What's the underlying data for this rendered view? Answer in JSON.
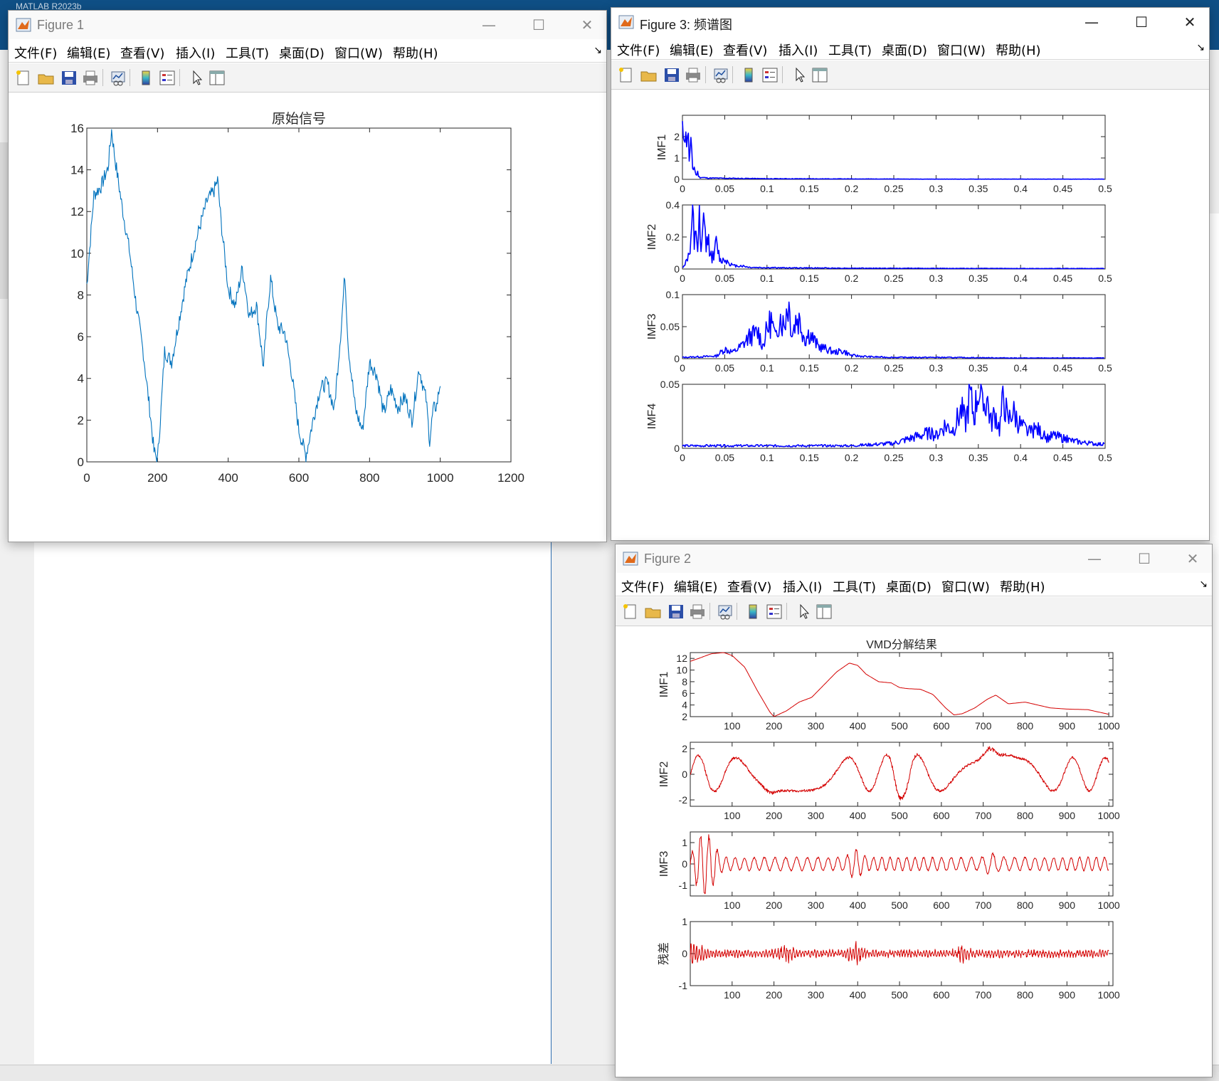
{
  "background": {
    "app_title": "MATLAB R2023b"
  },
  "menu": [
    "文件(F)",
    "编辑(E)",
    "查看(V)",
    "插入(I)",
    "工具(T)",
    "桌面(D)",
    "窗口(W)",
    "帮助(H)"
  ],
  "toolbar_icons": [
    "new-figure-icon",
    "open-file-icon",
    "save-icon",
    "print-icon",
    "link-plot-icon",
    "colorbar-icon",
    "legend-icon",
    "pointer-icon",
    "property-editor-icon"
  ],
  "window_controls": {
    "minimize": "—",
    "maximize": "☐",
    "close": "✕"
  },
  "windows": {
    "fig1": {
      "title": "Figure 1"
    },
    "fig3": {
      "title": "Figure 3: 频谱图"
    },
    "fig2": {
      "title": "Figure 2"
    }
  },
  "colors": {
    "blue_line": "#0072bd",
    "spectrum_line": "#0000ff",
    "vmd_line": "#d40000",
    "axis": "#262626"
  },
  "chart_data": [
    {
      "id": "original",
      "type": "line",
      "title": "原始信号",
      "xlim": [
        0,
        1200
      ],
      "ylim": [
        0,
        16
      ],
      "xticks": [
        0,
        200,
        400,
        600,
        800,
        1000,
        1200
      ],
      "yticks": [
        0,
        2,
        4,
        6,
        8,
        10,
        12,
        14,
        16
      ],
      "series": [
        {
          "x": [
            0,
            20,
            40,
            60,
            70,
            80,
            100,
            120,
            140,
            160,
            180,
            190,
            200,
            210,
            220,
            240,
            260,
            280,
            300,
            320,
            340,
            360,
            370,
            380,
            400,
            420,
            440,
            460,
            480,
            500,
            510,
            520,
            540,
            560,
            580,
            600,
            620,
            640,
            660,
            680,
            700,
            720,
            730,
            740,
            760,
            780,
            800,
            820,
            840,
            860,
            880,
            900,
            920,
            940,
            960,
            970,
            980,
            990,
            1000
          ],
          "y": [
            8.5,
            12.8,
            13.2,
            14.1,
            15.9,
            14.5,
            12.2,
            10.2,
            7.5,
            5.2,
            2.2,
            0.5,
            0.1,
            2.5,
            5.3,
            4.8,
            6.7,
            8.6,
            10.0,
            11.3,
            12.5,
            13.0,
            13.5,
            11.5,
            8.3,
            7.5,
            9.3,
            7.0,
            7.5,
            4.5,
            7.0,
            8.8,
            6.5,
            6.2,
            4.2,
            1.5,
            0.3,
            2.0,
            3.5,
            3.8,
            2.5,
            6.5,
            9.0,
            5.5,
            2.5,
            1.5,
            4.8,
            4.2,
            2.3,
            3.5,
            2.6,
            3.1,
            2.0,
            4.5,
            3.0,
            1.0,
            2.5,
            2.7,
            3.8
          ]
        }
      ]
    },
    {
      "id": "spectrum",
      "type": "line",
      "panels": [
        {
          "ylabel": "IMF1",
          "ylim": [
            0,
            3
          ],
          "yticks": [
            0,
            1,
            2
          ],
          "xlim": [
            0,
            0.5
          ],
          "x": [
            0,
            0.002,
            0.004,
            0.006,
            0.008,
            0.01,
            0.012,
            0.014,
            0.016,
            0.018,
            0.02,
            0.025,
            0.03,
            0.05,
            0.1,
            0.2,
            0.3,
            0.4,
            0.5
          ],
          "y": [
            2.0,
            2.8,
            1.8,
            2.4,
            1.0,
            1.5,
            0.5,
            0.6,
            0.2,
            0.3,
            0.1,
            0.08,
            0.06,
            0.05,
            0.03,
            0.02,
            0.01,
            0.01,
            0.01
          ]
        },
        {
          "ylabel": "IMF2",
          "ylim": [
            0,
            0.4
          ],
          "yticks": [
            0,
            0.2,
            0.4
          ],
          "xlim": [
            0,
            0.5
          ],
          "x": [
            0,
            0.005,
            0.01,
            0.012,
            0.014,
            0.016,
            0.018,
            0.02,
            0.022,
            0.024,
            0.026,
            0.028,
            0.03,
            0.035,
            0.04,
            0.045,
            0.05,
            0.06,
            0.07,
            0.08,
            0.1,
            0.2,
            0.3,
            0.4,
            0.5
          ],
          "y": [
            0.01,
            0.05,
            0.15,
            0.38,
            0.1,
            0.25,
            0.12,
            0.28,
            0.08,
            0.2,
            0.37,
            0.1,
            0.2,
            0.06,
            0.15,
            0.05,
            0.06,
            0.02,
            0.02,
            0.01,
            0.008,
            0.005,
            0.004,
            0.003,
            0.003
          ]
        },
        {
          "ylabel": "IMF3",
          "ylim": [
            0,
            0.1
          ],
          "yticks": [
            0,
            0.05,
            0.1
          ],
          "xlim": [
            0,
            0.5
          ],
          "x": [
            0,
            0.02,
            0.04,
            0.05,
            0.06,
            0.07,
            0.08,
            0.09,
            0.095,
            0.1,
            0.105,
            0.11,
            0.115,
            0.12,
            0.125,
            0.13,
            0.135,
            0.14,
            0.145,
            0.15,
            0.16,
            0.17,
            0.18,
            0.19,
            0.2,
            0.22,
            0.25,
            0.3,
            0.4,
            0.5
          ],
          "y": [
            0.002,
            0.003,
            0.004,
            0.015,
            0.01,
            0.02,
            0.035,
            0.04,
            0.02,
            0.045,
            0.06,
            0.03,
            0.07,
            0.05,
            0.09,
            0.04,
            0.065,
            0.055,
            0.03,
            0.04,
            0.02,
            0.015,
            0.01,
            0.012,
            0.005,
            0.003,
            0.002,
            0.002,
            0.001,
            0.001
          ]
        },
        {
          "ylabel": "IMF4",
          "ylim": [
            0,
            0.05
          ],
          "yticks": [
            0,
            0.05
          ],
          "xlim": [
            0,
            0.5
          ],
          "x": [
            0,
            0.1,
            0.2,
            0.25,
            0.27,
            0.29,
            0.3,
            0.31,
            0.32,
            0.33,
            0.335,
            0.34,
            0.345,
            0.35,
            0.355,
            0.36,
            0.365,
            0.37,
            0.375,
            0.38,
            0.385,
            0.39,
            0.4,
            0.41,
            0.42,
            0.43,
            0.44,
            0.46,
            0.48,
            0.5
          ],
          "y": [
            0.002,
            0.002,
            0.002,
            0.004,
            0.008,
            0.012,
            0.01,
            0.018,
            0.015,
            0.03,
            0.02,
            0.042,
            0.025,
            0.048,
            0.03,
            0.04,
            0.02,
            0.028,
            0.015,
            0.042,
            0.02,
            0.03,
            0.018,
            0.012,
            0.015,
            0.008,
            0.01,
            0.006,
            0.004,
            0.003
          ]
        }
      ],
      "xticks": [
        0,
        0.05,
        0.1,
        0.15,
        0.2,
        0.25,
        0.3,
        0.35,
        0.4,
        0.45,
        0.5
      ],
      "xtick_labels": [
        "0",
        "0.05",
        "0.1",
        "0.15",
        "0.2",
        "0.25",
        "0.3",
        "0.35",
        "0.4",
        "0.45",
        "0.5"
      ]
    },
    {
      "id": "vmd",
      "type": "line",
      "title": "VMD分解结果",
      "xlim": [
        0,
        1010
      ],
      "xticks": [
        100,
        200,
        300,
        400,
        500,
        600,
        700,
        800,
        900,
        1000
      ],
      "panels": [
        {
          "ylabel": "IMF1",
          "ylim": [
            2,
            13
          ],
          "yticks": [
            2,
            4,
            6,
            8,
            10,
            12
          ],
          "x": [
            0,
            20,
            50,
            80,
            100,
            130,
            160,
            190,
            200,
            230,
            260,
            290,
            320,
            350,
            380,
            400,
            420,
            450,
            480,
            500,
            520,
            550,
            580,
            610,
            630,
            650,
            680,
            710,
            730,
            760,
            800,
            830,
            860,
            900,
            950,
            1000
          ],
          "y": [
            11.5,
            12.0,
            12.8,
            13.0,
            12.5,
            10.5,
            6.5,
            2.8,
            2.0,
            3.0,
            4.5,
            5.3,
            7.5,
            9.7,
            11.2,
            10.8,
            9.3,
            8.0,
            7.8,
            7.0,
            6.8,
            6.7,
            5.8,
            3.5,
            2.3,
            2.5,
            3.5,
            5.0,
            5.7,
            4.2,
            4.5,
            4.0,
            3.5,
            3.3,
            3.2,
            2.4
          ]
        },
        {
          "ylabel": "IMF2",
          "ylim": [
            -2.5,
            2.5
          ],
          "yticks": [
            -2,
            0,
            2
          ],
          "seed": 2,
          "amp": 1.3,
          "freq": 0.045,
          "noise": 0.2,
          "bursts": [
            [
              30,
              1.2
            ],
            [
              190,
              1.3
            ],
            [
              490,
              1.6
            ],
            [
              525,
              1.5
            ],
            [
              715,
              1.7
            ],
            [
              755,
              1.2
            ]
          ]
        },
        {
          "ylabel": "IMF3",
          "ylim": [
            -1.5,
            1.5
          ],
          "yticks": [
            -1,
            0,
            1
          ],
          "seed": 3,
          "amp": 0.3,
          "freq": 0.28,
          "noise": 0.08,
          "bursts": [
            [
              25,
              4.0
            ],
            [
              50,
              3.5
            ],
            [
              395,
              2.2
            ],
            [
              720,
              1.6
            ]
          ]
        },
        {
          "ylabel": "残差",
          "ylim": [
            -1,
            1
          ],
          "yticks": [
            -1,
            0,
            1
          ],
          "seed": 4,
          "amp": 0.08,
          "freq": 0.9,
          "noise": 0.12,
          "bursts": [
            [
              10,
              4.0
            ],
            [
              230,
              2.5
            ],
            [
              395,
              2.8
            ],
            [
              650,
              2.2
            ]
          ]
        }
      ]
    }
  ]
}
